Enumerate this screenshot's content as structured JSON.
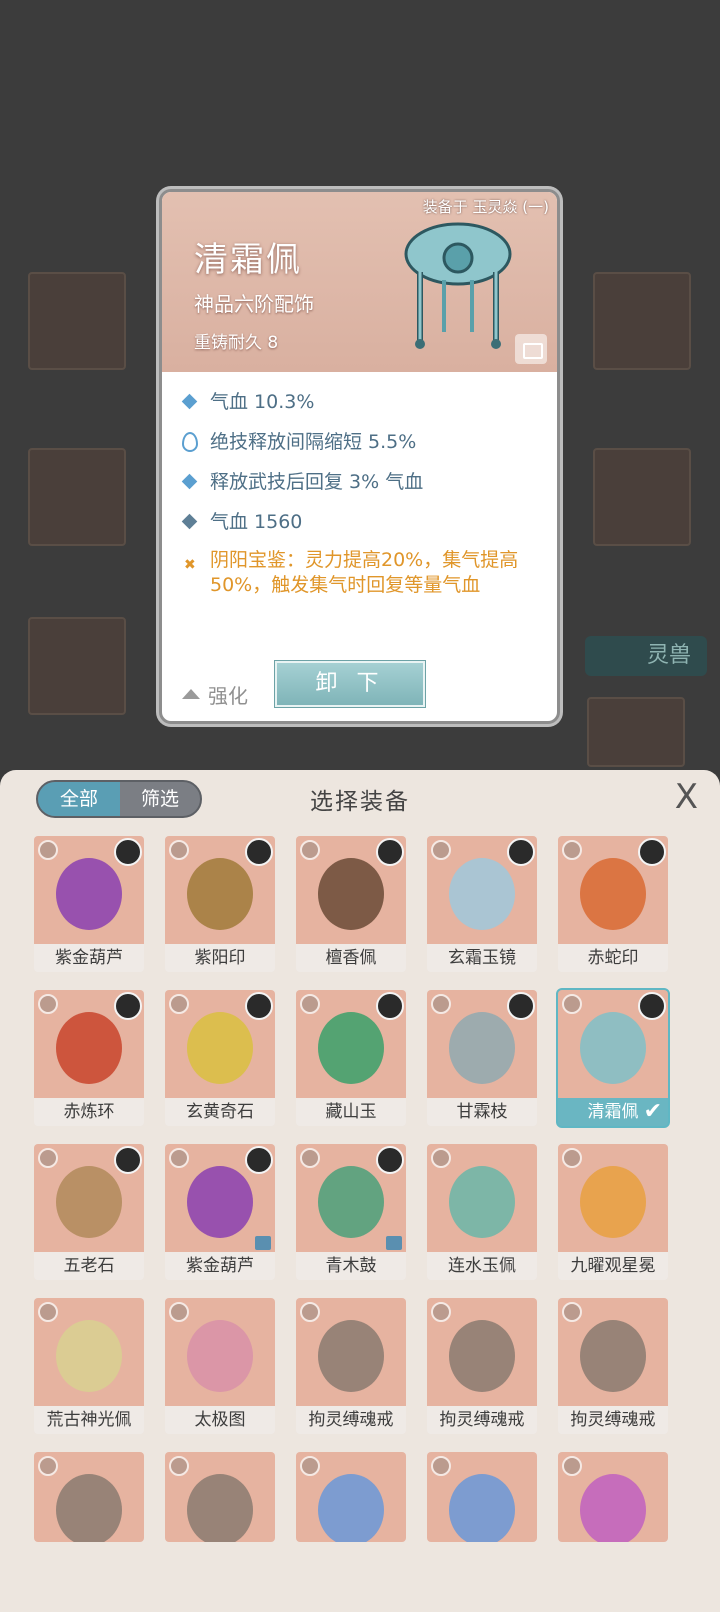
{
  "detail": {
    "equipped_on": "装备于 玉灵焱 (一)",
    "name": "清霜佩",
    "grade": "神品六阶配饰",
    "durability": "重铸耐久 8",
    "stats": [
      "气血 10.3%",
      "绝技释放间隔缩短 5.5%",
      "释放武技后回复 3% 气血",
      "气血 1560"
    ],
    "special": "阴阳宝鉴：灵力提高20%，集气提高50%，触发集气时回复等量气血",
    "enhance_label": "强化",
    "unequip_label": "卸 下"
  },
  "background": {
    "side_tab": "灵兽"
  },
  "panel": {
    "tab_all": "全部",
    "tab_filter": "筛选",
    "title": "选择装备",
    "close": "X"
  },
  "items": [
    {
      "name": "紫金葫芦",
      "color": "#8a3fb0"
    },
    {
      "name": "紫阳印",
      "color": "#a07a3a"
    },
    {
      "name": "檀香佩",
      "color": "#6a4a36"
    },
    {
      "name": "玄霜玉镜",
      "color": "#9fc8dc"
    },
    {
      "name": "赤蛇印",
      "color": "#d86a32"
    },
    {
      "name": "赤炼环",
      "color": "#c8442c"
    },
    {
      "name": "玄黄奇石",
      "color": "#d9c040"
    },
    {
      "name": "藏山玉",
      "color": "#3aa06a"
    },
    {
      "name": "甘霖枝",
      "color": "#8fa9b0"
    },
    {
      "name": "清霜佩",
      "color": "#7fc0c8"
    },
    {
      "name": "五老石",
      "color": "#b08a5a"
    },
    {
      "name": "紫金葫芦",
      "color": "#8a3fb0"
    },
    {
      "name": "青木鼓",
      "color": "#4aa07a"
    },
    {
      "name": "连水玉佩",
      "color": "#6ab6a8"
    },
    {
      "name": "九曜观星冕",
      "color": "#e8a040"
    },
    {
      "name": "荒古神光佩",
      "color": "#d8d090"
    },
    {
      "name": "太极图",
      "color": "#d890a8"
    },
    {
      "name": "拘灵缚魂戒",
      "color": "#8a7a70"
    },
    {
      "name": "拘灵缚魂戒",
      "color": "#8a7a70"
    },
    {
      "name": "拘灵缚魂戒",
      "color": "#8a7a70"
    },
    {
      "name": "",
      "color": "#8a7a70"
    },
    {
      "name": "",
      "color": "#8a7a70"
    },
    {
      "name": "",
      "color": "#6a98d8"
    },
    {
      "name": "",
      "color": "#6a98d8"
    },
    {
      "name": "",
      "color": "#c060c0"
    }
  ],
  "selected_index": 9,
  "locked_indices": [
    11,
    12
  ],
  "avatar_indices": [
    0,
    1,
    2,
    3,
    4,
    5,
    6,
    7,
    8,
    9,
    10,
    11,
    12
  ]
}
